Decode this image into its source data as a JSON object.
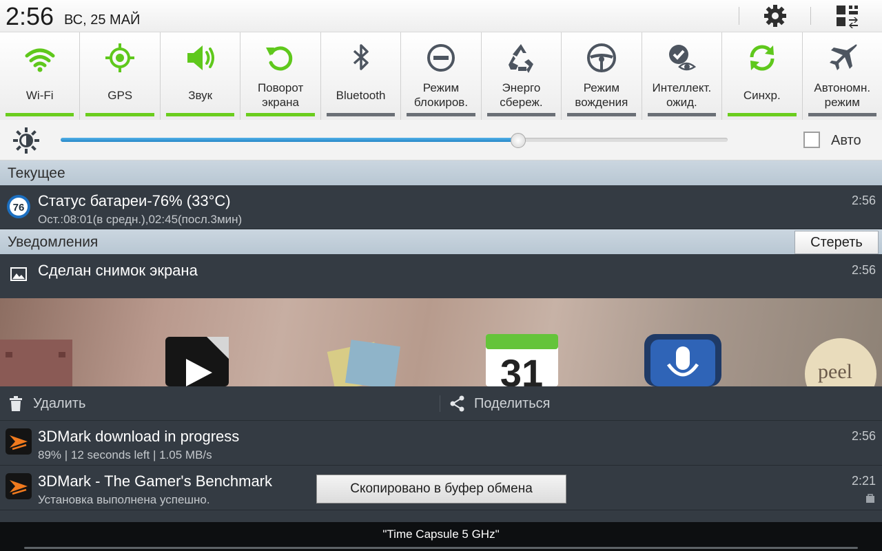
{
  "status_bar": {
    "time": "2:56",
    "date": "ВС, 25 МАЙ",
    "icons": [
      "gear-icon",
      "quick-settings-grid-icon"
    ]
  },
  "toggles": [
    {
      "id": "wifi",
      "label": "Wi-Fi",
      "icon": "wifi-icon",
      "on": true
    },
    {
      "id": "gps",
      "label": "GPS",
      "icon": "gps-icon",
      "on": true
    },
    {
      "id": "sound",
      "label": "Звук",
      "icon": "speaker-icon",
      "on": true
    },
    {
      "id": "rotation",
      "label": "Поворот\nэкрана",
      "icon": "rotate-icon",
      "on": true
    },
    {
      "id": "bluetooth",
      "label": "Bluetooth",
      "icon": "bluetooth-icon",
      "on": false
    },
    {
      "id": "block",
      "label": "Режим\nблокиров.",
      "icon": "block-icon",
      "on": false
    },
    {
      "id": "power",
      "label": "Энерго\nсбереж.",
      "icon": "recycle-icon",
      "on": false
    },
    {
      "id": "driving",
      "label": "Режим\nвождения",
      "icon": "steering-wheel-icon",
      "on": false
    },
    {
      "id": "smartstay",
      "label": "Интеллект.\nожид.",
      "icon": "eye-icon",
      "on": false
    },
    {
      "id": "sync",
      "label": "Синхр.",
      "icon": "sync-icon",
      "on": true
    },
    {
      "id": "airplane",
      "label": "Автономн.\nрежим",
      "icon": "airplane-icon",
      "on": false
    }
  ],
  "brightness": {
    "level": 0.685,
    "auto_label": "Авто",
    "auto_checked": false
  },
  "current_section": {
    "title": "Текущее"
  },
  "battery_notification": {
    "badge": "76",
    "title": "Статус батареи-76% (33°C)",
    "subtitle": "Ост.:08:01(в средн.),02:45(посл.3мин)",
    "time": "2:56"
  },
  "notifications_section": {
    "title": "Уведомления",
    "clear_label": "Стереть"
  },
  "screenshot_notification": {
    "title": "Сделан снимок экрана",
    "time": "2:56",
    "delete_label": "Удалить",
    "share_label": "Поделиться"
  },
  "download_notification": {
    "title": "3DMark download in progress",
    "subtitle": "89% | 12 seconds left | 1.05 MB/s",
    "time": "2:56"
  },
  "install_notification": {
    "title": "3DMark - The Gamer's Benchmark",
    "subtitle": "Установка выполнена успешно.",
    "time": "2:21"
  },
  "toast": {
    "text": "Скопировано в буфер обмена"
  },
  "bottom_bar": {
    "ssid": "\"Time Capsule 5 GHz\""
  },
  "colors": {
    "accent_on": "#6acd1d",
    "accent_off": "#6a6f76",
    "slider": "#2486c7",
    "panel_dark": "#343b43"
  }
}
